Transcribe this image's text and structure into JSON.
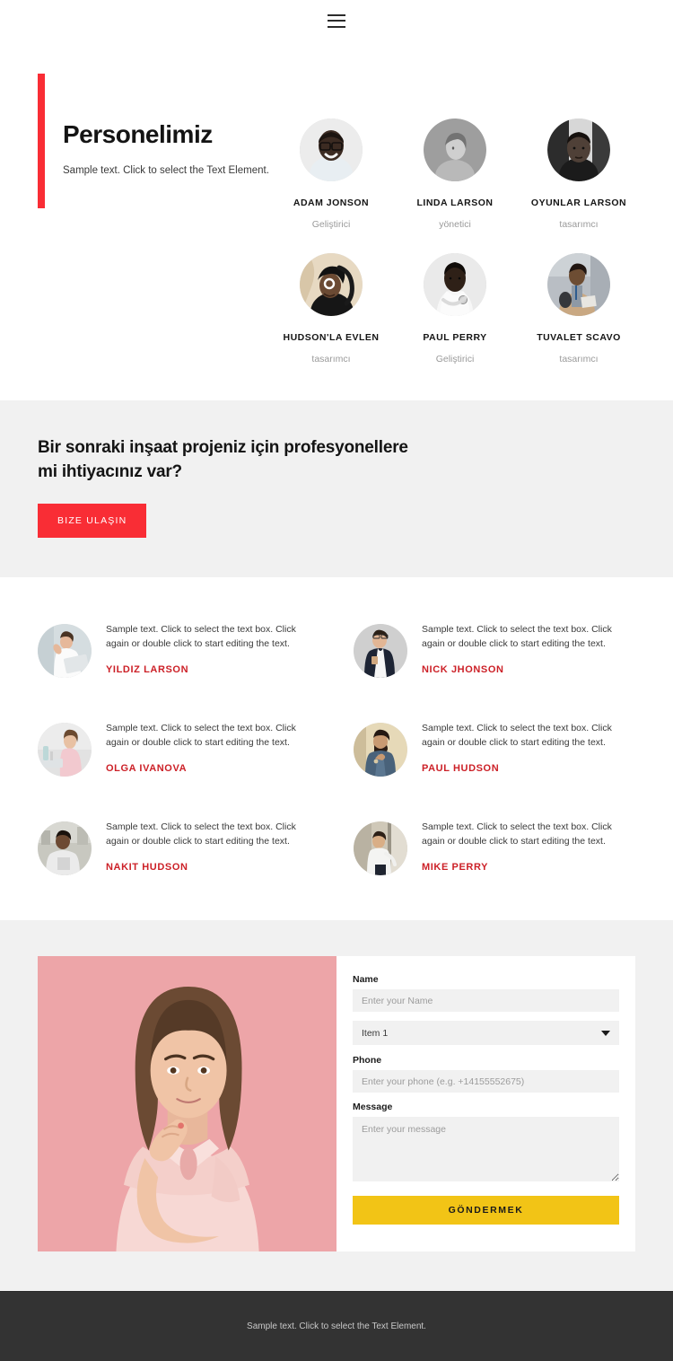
{
  "header": {
    "menu_icon": "hamburger-menu-icon"
  },
  "team": {
    "title": "Personelimiz",
    "subtitle": "Sample text. Click to select the Text Element.",
    "accent_color": "#f92d35",
    "members": [
      {
        "name": "ADAM JONSON",
        "role": "Geliştirici"
      },
      {
        "name": "LINDA LARSON",
        "role": "yönetici"
      },
      {
        "name": "OYUNLAR LARSON",
        "role": "tasarımcı"
      },
      {
        "name": "HUDSON'LA EVLEN",
        "role": "tasarımcı"
      },
      {
        "name": "PAUL PERRY",
        "role": "Geliştirici"
      },
      {
        "name": "TUVALET SCAVO",
        "role": "tasarımcı"
      }
    ]
  },
  "cta": {
    "title": "Bir sonraki inşaat projeniz için profesyonellere mi ihtiyacınız var?",
    "button_label": "BIZE ULAŞIN",
    "button_color": "#f92d35",
    "background_color": "#f1f1f1"
  },
  "testimonials": {
    "name_color": "#cc2027",
    "items": [
      {
        "text": "Sample text. Click to select the text box. Click again or double click to start editing the text.",
        "name": "YILDIZ LARSON"
      },
      {
        "text": "Sample text. Click to select the text box. Click again or double click to start editing the text.",
        "name": "NICK JHONSON"
      },
      {
        "text": "Sample text. Click to select the text box. Click again or double click to start editing the text.",
        "name": "OLGA IVANOVA"
      },
      {
        "text": "Sample text. Click to select the text box. Click again or double click to start editing the text.",
        "name": "PAUL HUDSON"
      },
      {
        "text": "Sample text. Click to select the text box. Click again or double click to start editing the text.",
        "name": "NAKIT HUDSON"
      },
      {
        "text": "Sample text. Click to select the text box. Click again or double click to start editing the text.",
        "name": "MIKE PERRY"
      }
    ]
  },
  "contact": {
    "photo_alt": "woman-portrait-pink-background",
    "name_label": "Name",
    "name_placeholder": "Enter your Name",
    "select_value": "Item 1",
    "select_options": [
      "Item 1"
    ],
    "phone_label": "Phone",
    "phone_placeholder": "Enter your phone (e.g. +14155552675)",
    "message_label": "Message",
    "message_placeholder": "Enter your message",
    "submit_label": "GÖNDERMEK",
    "submit_color": "#f2c416"
  },
  "footer": {
    "text": "Sample text. Click to select the Text Element.",
    "background_color": "#333333"
  }
}
